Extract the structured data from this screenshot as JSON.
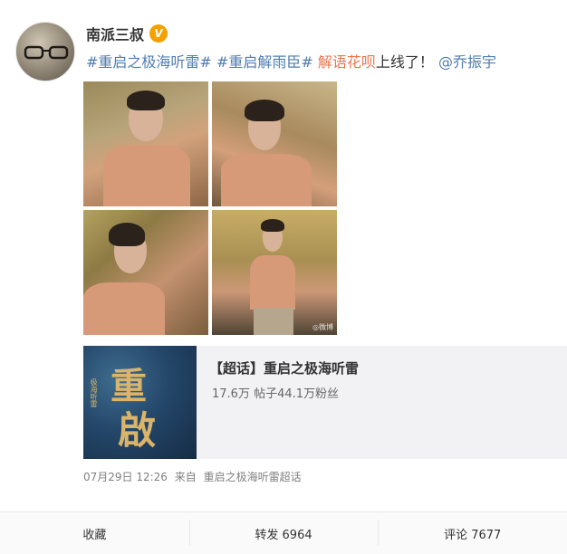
{
  "author": {
    "name": "南派三叔",
    "verified_badge": "V"
  },
  "post": {
    "tag1": "#重启之极海听雷#",
    "tag2": "#重启解雨臣#",
    "highlight": "解语花呗",
    "plain": "上线了！",
    "mention": "@乔振宇"
  },
  "photos": {
    "count": 4,
    "watermark": "◎微博"
  },
  "topic_card": {
    "title": "【超话】重启之极海听雷",
    "stats": "17.6万 帖子44.1万粉丝",
    "cover_glyph_top": "重",
    "cover_glyph_bottom": "啟",
    "cover_vertical_text": "极海听雷"
  },
  "meta": {
    "timestamp": "07月29日 12:26",
    "source_prefix": "来自",
    "source": "重启之极海听雷超话"
  },
  "actions": {
    "favorite": "收藏",
    "repost": "转发 6964",
    "comment": "评论 7677"
  },
  "colors": {
    "tag": "#eb7350",
    "link": "#507daf",
    "badge": "#f4a100"
  }
}
